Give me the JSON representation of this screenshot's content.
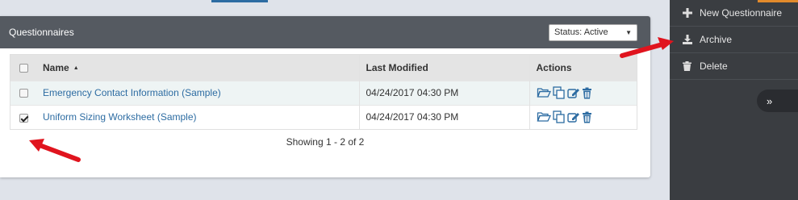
{
  "header": {
    "title": "Questionnaires",
    "status_filter": "Status: Active"
  },
  "table": {
    "columns": {
      "name": "Name",
      "last_modified": "Last Modified",
      "actions": "Actions"
    },
    "rows": [
      {
        "name": "Emergency Contact Information (Sample)",
        "last_modified": "04/24/2017 04:30 PM",
        "checked": false
      },
      {
        "name": "Uniform Sizing Worksheet (Sample)",
        "last_modified": "04/24/2017 04:30 PM",
        "checked": true
      }
    ]
  },
  "pager": {
    "text": "Showing 1 - 2 of 2"
  },
  "sidebar": {
    "items": [
      {
        "label": "New Questionnaire",
        "icon": "plus-icon"
      },
      {
        "label": "Archive",
        "icon": "download-icon"
      },
      {
        "label": "Delete",
        "icon": "trash-icon"
      }
    ],
    "collapse_label": "»"
  },
  "colors": {
    "accent": "#2d6ca2",
    "header_bg": "#555a61",
    "sidebar_bg": "#3a3d41",
    "arrow": "#e0141e"
  }
}
